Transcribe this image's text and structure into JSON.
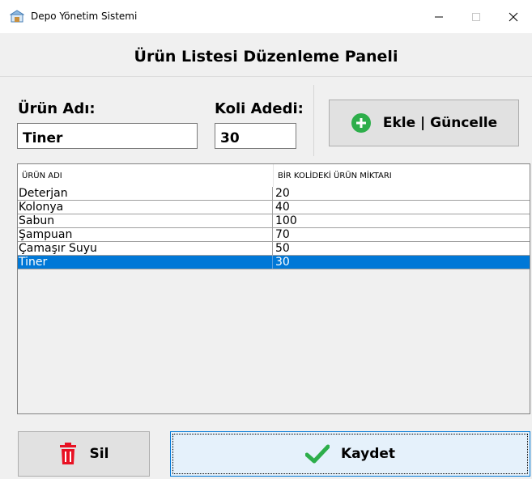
{
  "window": {
    "title": "Depo Yönetim Sistemi"
  },
  "panel": {
    "title": "Ürün Listesi Düzenleme Paneli"
  },
  "form": {
    "name_label": "Ürün Adı:",
    "name_value": "Tiner",
    "qty_label": "Koli Adedi:",
    "qty_value": "30",
    "add_button_label": "Ekle | Güncelle"
  },
  "list": {
    "columns": [
      "ÜRÜN ADI",
      "BİR KOLİDEKİ ÜRÜN MİKTARI"
    ],
    "rows": [
      {
        "name": "Deterjan",
        "qty": "20"
      },
      {
        "name": "Kolonya",
        "qty": "40"
      },
      {
        "name": "Sabun",
        "qty": "100"
      },
      {
        "name": "Şampuan",
        "qty": "70"
      },
      {
        "name": "Çamaşır Suyu",
        "qty": "50"
      },
      {
        "name": "Tiner",
        "qty": "30"
      }
    ],
    "selected_index": 5
  },
  "actions": {
    "delete_label": "Sil",
    "save_label": "Kaydet"
  },
  "colors": {
    "selection": "#0078d7",
    "add_icon": "#2dae4a",
    "delete_icon": "#e81123",
    "save_check": "#2dae4a"
  },
  "icons": {
    "app": "warehouse-icon",
    "add": "plus-circle-icon",
    "delete": "trash-icon",
    "save": "check-icon"
  }
}
